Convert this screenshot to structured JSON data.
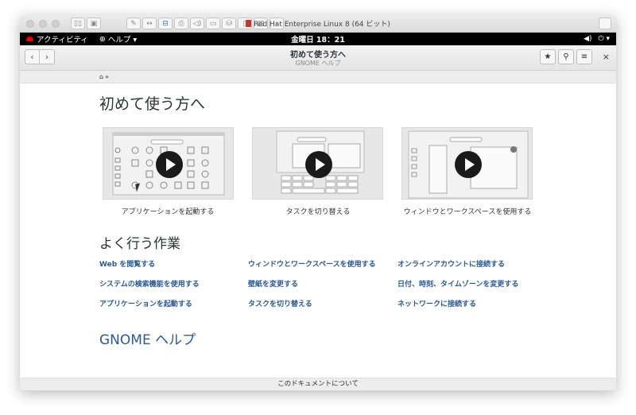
{
  "vm": {
    "title": "Red Hat Enterprise Linux 8 (64 ビット)"
  },
  "gnome_bar": {
    "activities": "アクティビティ",
    "help_menu": "ヘルプ ▾",
    "clock": "金曜日 18：21",
    "tray_volume": "◀)",
    "tray_power": "⏻ ▾"
  },
  "header": {
    "title": "初めて使う方へ",
    "subtitle": "GNOME ヘルプ",
    "back_icon": "‹",
    "forward_icon": "›",
    "bookmark_icon": "★",
    "search_icon": "⚲",
    "menu_icon": "≡",
    "close_icon": "×"
  },
  "breadcrumb": {
    "text": "»"
  },
  "page": {
    "title": "初めて使う方へ",
    "videos": [
      {
        "caption": "アプリケーションを起動する"
      },
      {
        "caption": "タスクを切り替える"
      },
      {
        "caption": "ウィンドウとワークスペースを使用する"
      }
    ],
    "common_tasks_heading": "よく行う作業",
    "links": [
      "Web を閲覧する",
      "ウィンドウとワークスペースを使用する",
      "オンラインアカウントに接続する",
      "システムの検索機能を使用する",
      "壁紙を変更する",
      "日付、時刻、タイムゾーンを変更する",
      "アプリケーションを起動する",
      "タスクを切り替える",
      "ネットワークに接続する"
    ],
    "gnome_help_link": "GNOME ヘルプ"
  },
  "footer": {
    "text": "このドキュメントについて"
  }
}
